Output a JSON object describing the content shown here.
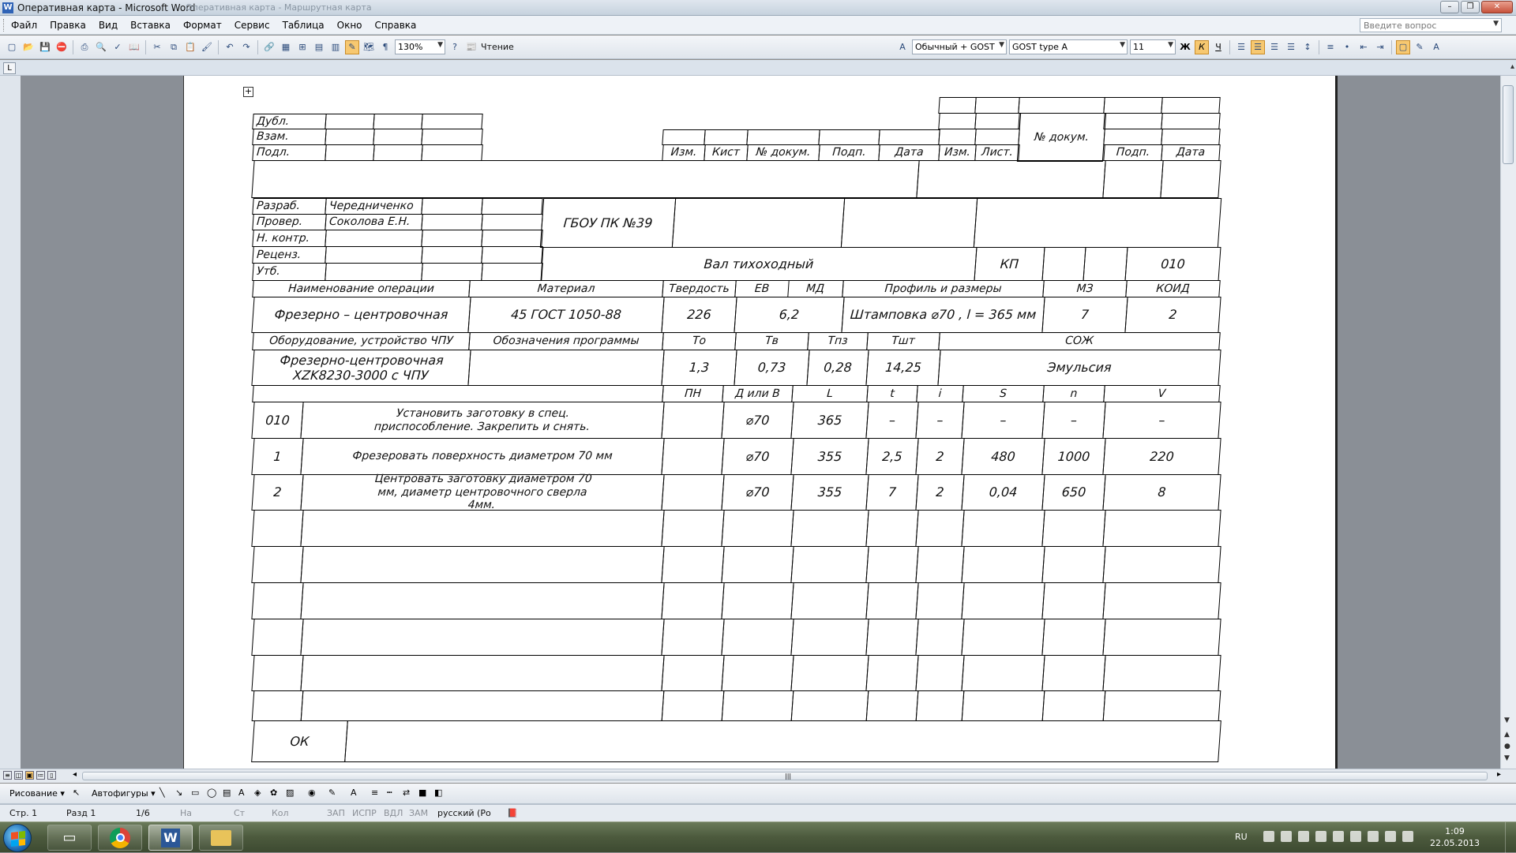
{
  "window": {
    "title": "Оперативная карта - Microsoft Word",
    "ghost_tab": "Оперативная карта - Маршрутная карта"
  },
  "menu": {
    "items": [
      "Файл",
      "Правка",
      "Вид",
      "Вставка",
      "Формат",
      "Сервис",
      "Таблица",
      "Окно",
      "Справка"
    ],
    "help_placeholder": "Введите вопрос"
  },
  "toolbar": {
    "zoom": "130%",
    "reading": "Чтение",
    "style": "Обычный + GOST",
    "font": "GOST type A",
    "size": "11",
    "bold": "Ж",
    "italic": "К",
    "underline": "Ч"
  },
  "form": {
    "left_labels": [
      "Дубл.",
      "Взам.",
      "Подл."
    ],
    "rev_headers_left": [
      "Изм.",
      "Кист",
      "№ докум.",
      "Подп.",
      "Дата"
    ],
    "rev_headers_right": [
      "Изм.",
      "Лист.",
      "№ докум.",
      "Подп.",
      "Дата"
    ],
    "signers": [
      {
        "role": "Разраб.",
        "name": "Чередниченко"
      },
      {
        "role": "Провер.",
        "name": "Соколова Е.Н."
      },
      {
        "role": "Н. контр.",
        "name": ""
      },
      {
        "role": "Реценз.",
        "name": ""
      },
      {
        "role": "Утб.",
        "name": ""
      }
    ],
    "org": "ГБОУ ПК №39",
    "part_name": "Вал тихоходный",
    "doc_type": "КП",
    "op_number": "010",
    "op_headers": {
      "name": "Наименование операции",
      "material": "Материал",
      "hardness": "Твердость",
      "ev": "ЕВ",
      "md": "МД",
      "profile": "Профиль и размеры",
      "mz": "МЗ",
      "koid": "КОИД"
    },
    "op_values": {
      "name": "Фрезерно – центровочная",
      "material": "45 ГОСТ 1050-88",
      "hardness": "226",
      "ev_md": "6,2",
      "profile": "Штамповка ⌀70 , l = 365 мм",
      "mz": "7",
      "koid": "2"
    },
    "eq_headers": {
      "equipment": "Оборудование, устройство ЧПУ",
      "program": "Обозначения программы",
      "to": "То",
      "tv": "Тв",
      "tpz": "Тпз",
      "tsht": "Тшт",
      "coolant": "СОЖ"
    },
    "eq_values": {
      "equipment": "Фрезерно-центровочная XZK8230-3000 с ЧПУ",
      "to": "1,3",
      "tv": "0,73",
      "tpz": "0,28",
      "tsht": "14,25",
      "coolant": "Эмульсия"
    },
    "step_headers": [
      "ПН",
      "Д или В",
      "L",
      "t",
      "i",
      "S",
      "n",
      "V"
    ],
    "steps": [
      {
        "num": "010",
        "text": "Установить заготовку в спец. приспособление. Закрепить и снять.",
        "d": "⌀70",
        "L": "365",
        "t": "–",
        "i": "–",
        "S": "–",
        "n": "–",
        "V": "–"
      },
      {
        "num": "1",
        "text": "Фрезеровать  поверхность диаметром 70 мм",
        "d": "⌀70",
        "L": "355",
        "t": "2,5",
        "i": "2",
        "S": "480",
        "n": "1000",
        "V": "220"
      },
      {
        "num": "2",
        "text": "Центровать заготовку диаметром 70 мм, диаметр центровочного сверла 4мм.",
        "d": "⌀70",
        "L": "355",
        "t": "7",
        "i": "2",
        "S": "0,04",
        "n": "650",
        "V": "8"
      }
    ],
    "ok_label": "ОК"
  },
  "drawbar": {
    "drawing": "Рисование",
    "autoshapes": "Автофигуры"
  },
  "status": {
    "page": "Стр. 1",
    "section": "Разд 1",
    "pages": "1/6",
    "at": "На",
    "ln": "Ст",
    "col": "Кол",
    "rec": "ЗАП",
    "trk": "ИСПР",
    "ext": "ВДЛ",
    "ovr": "ЗАМ",
    "lang": "русский (Ро"
  },
  "taskbar": {
    "lang": "RU",
    "time": "1:09",
    "date": "22.05.2013"
  }
}
